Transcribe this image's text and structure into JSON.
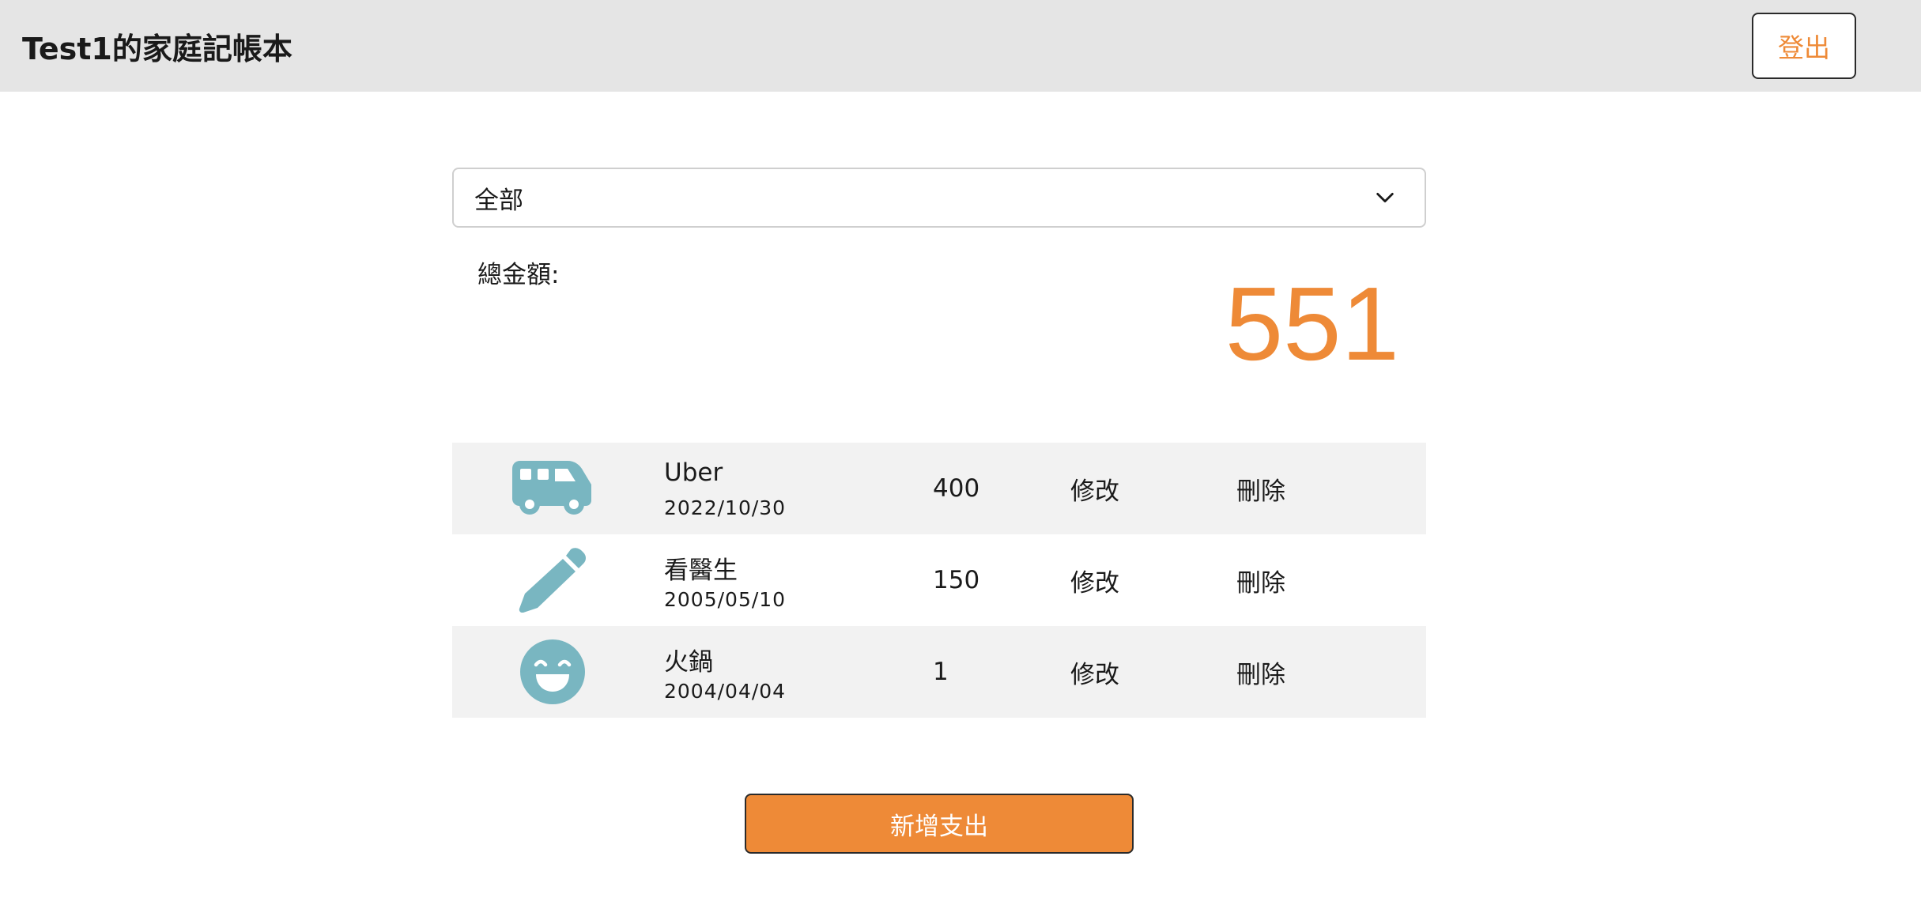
{
  "header": {
    "title": "Test1的家庭記帳本",
    "logout_label": "登出"
  },
  "filter": {
    "selected": "全部",
    "icon": "chevron-down-icon"
  },
  "summary": {
    "label": "總金額:",
    "total": "551"
  },
  "expenses": [
    {
      "icon": "bus-icon",
      "name": "Uber",
      "date": "2022/10/30",
      "amount": "400",
      "edit_label": "修改",
      "delete_label": "刪除"
    },
    {
      "icon": "pencil-icon",
      "name": "看醫生",
      "date": "2005/05/10",
      "amount": "150",
      "edit_label": "修改",
      "delete_label": "刪除"
    },
    {
      "icon": "smile-icon",
      "name": "火鍋",
      "date": "2004/04/04",
      "amount": "1",
      "edit_label": "修改",
      "delete_label": "刪除"
    }
  ],
  "add_button_label": "新增支出",
  "colors": {
    "accent": "#ee8a37",
    "icon": "#79b6c1",
    "header_bg": "#e5e5e5",
    "row_shaded": "#f2f2f2"
  }
}
